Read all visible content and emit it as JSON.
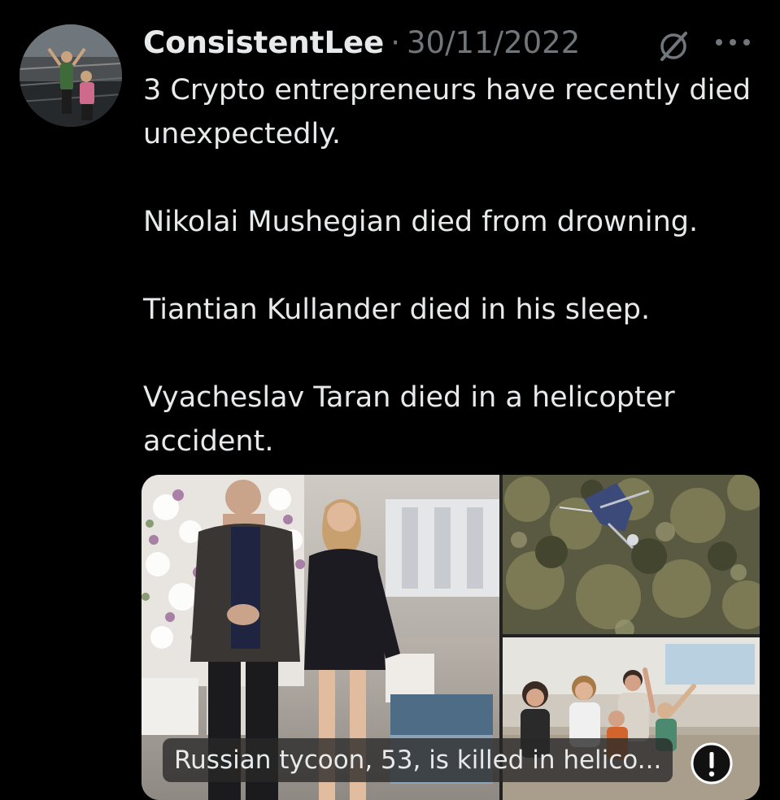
{
  "tweet": {
    "author_name": "ConsistentLee",
    "separator": "·",
    "timestamp": "30/11/2022",
    "paragraphs": [
      "3 Crypto entrepreneurs have recently died unexpectedly.",
      "Nikolai Mushegian died from drowning.",
      "Tiantian Kullander died in his sleep.",
      "Vyacheslav Taran died in a helicopter accident."
    ],
    "media": {
      "link_caption": "Russian tycoon, 53, is killed in helico..."
    }
  },
  "icons": {
    "avatar": "avatar-photo",
    "grok": "grok-icon",
    "more": "more-icon",
    "info": "info-icon"
  },
  "colors": {
    "background": "#000000",
    "text_primary": "#e7e9ea",
    "text_secondary": "#71767b"
  }
}
